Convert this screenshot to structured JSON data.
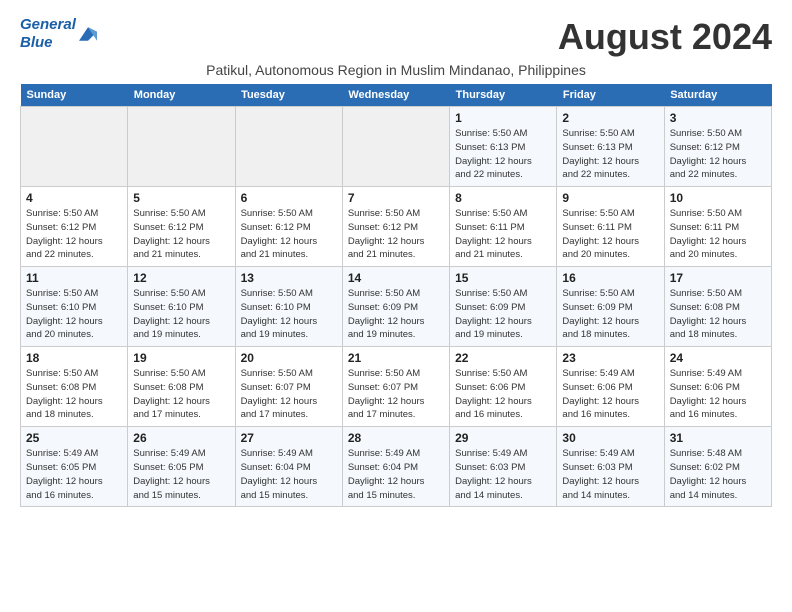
{
  "logo": {
    "line1": "General",
    "line2": "Blue"
  },
  "title": "August 2024",
  "subtitle": "Patikul, Autonomous Region in Muslim Mindanao, Philippines",
  "days_of_week": [
    "Sunday",
    "Monday",
    "Tuesday",
    "Wednesday",
    "Thursday",
    "Friday",
    "Saturday"
  ],
  "weeks": [
    [
      {
        "day": "",
        "info": ""
      },
      {
        "day": "",
        "info": ""
      },
      {
        "day": "",
        "info": ""
      },
      {
        "day": "",
        "info": ""
      },
      {
        "day": "1",
        "info": "Sunrise: 5:50 AM\nSunset: 6:13 PM\nDaylight: 12 hours\nand 22 minutes."
      },
      {
        "day": "2",
        "info": "Sunrise: 5:50 AM\nSunset: 6:13 PM\nDaylight: 12 hours\nand 22 minutes."
      },
      {
        "day": "3",
        "info": "Sunrise: 5:50 AM\nSunset: 6:12 PM\nDaylight: 12 hours\nand 22 minutes."
      }
    ],
    [
      {
        "day": "4",
        "info": "Sunrise: 5:50 AM\nSunset: 6:12 PM\nDaylight: 12 hours\nand 22 minutes."
      },
      {
        "day": "5",
        "info": "Sunrise: 5:50 AM\nSunset: 6:12 PM\nDaylight: 12 hours\nand 21 minutes."
      },
      {
        "day": "6",
        "info": "Sunrise: 5:50 AM\nSunset: 6:12 PM\nDaylight: 12 hours\nand 21 minutes."
      },
      {
        "day": "7",
        "info": "Sunrise: 5:50 AM\nSunset: 6:12 PM\nDaylight: 12 hours\nand 21 minutes."
      },
      {
        "day": "8",
        "info": "Sunrise: 5:50 AM\nSunset: 6:11 PM\nDaylight: 12 hours\nand 21 minutes."
      },
      {
        "day": "9",
        "info": "Sunrise: 5:50 AM\nSunset: 6:11 PM\nDaylight: 12 hours\nand 20 minutes."
      },
      {
        "day": "10",
        "info": "Sunrise: 5:50 AM\nSunset: 6:11 PM\nDaylight: 12 hours\nand 20 minutes."
      }
    ],
    [
      {
        "day": "11",
        "info": "Sunrise: 5:50 AM\nSunset: 6:10 PM\nDaylight: 12 hours\nand 20 minutes."
      },
      {
        "day": "12",
        "info": "Sunrise: 5:50 AM\nSunset: 6:10 PM\nDaylight: 12 hours\nand 19 minutes."
      },
      {
        "day": "13",
        "info": "Sunrise: 5:50 AM\nSunset: 6:10 PM\nDaylight: 12 hours\nand 19 minutes."
      },
      {
        "day": "14",
        "info": "Sunrise: 5:50 AM\nSunset: 6:09 PM\nDaylight: 12 hours\nand 19 minutes."
      },
      {
        "day": "15",
        "info": "Sunrise: 5:50 AM\nSunset: 6:09 PM\nDaylight: 12 hours\nand 19 minutes."
      },
      {
        "day": "16",
        "info": "Sunrise: 5:50 AM\nSunset: 6:09 PM\nDaylight: 12 hours\nand 18 minutes."
      },
      {
        "day": "17",
        "info": "Sunrise: 5:50 AM\nSunset: 6:08 PM\nDaylight: 12 hours\nand 18 minutes."
      }
    ],
    [
      {
        "day": "18",
        "info": "Sunrise: 5:50 AM\nSunset: 6:08 PM\nDaylight: 12 hours\nand 18 minutes."
      },
      {
        "day": "19",
        "info": "Sunrise: 5:50 AM\nSunset: 6:08 PM\nDaylight: 12 hours\nand 17 minutes."
      },
      {
        "day": "20",
        "info": "Sunrise: 5:50 AM\nSunset: 6:07 PM\nDaylight: 12 hours\nand 17 minutes."
      },
      {
        "day": "21",
        "info": "Sunrise: 5:50 AM\nSunset: 6:07 PM\nDaylight: 12 hours\nand 17 minutes."
      },
      {
        "day": "22",
        "info": "Sunrise: 5:50 AM\nSunset: 6:06 PM\nDaylight: 12 hours\nand 16 minutes."
      },
      {
        "day": "23",
        "info": "Sunrise: 5:49 AM\nSunset: 6:06 PM\nDaylight: 12 hours\nand 16 minutes."
      },
      {
        "day": "24",
        "info": "Sunrise: 5:49 AM\nSunset: 6:06 PM\nDaylight: 12 hours\nand 16 minutes."
      }
    ],
    [
      {
        "day": "25",
        "info": "Sunrise: 5:49 AM\nSunset: 6:05 PM\nDaylight: 12 hours\nand 16 minutes."
      },
      {
        "day": "26",
        "info": "Sunrise: 5:49 AM\nSunset: 6:05 PM\nDaylight: 12 hours\nand 15 minutes."
      },
      {
        "day": "27",
        "info": "Sunrise: 5:49 AM\nSunset: 6:04 PM\nDaylight: 12 hours\nand 15 minutes."
      },
      {
        "day": "28",
        "info": "Sunrise: 5:49 AM\nSunset: 6:04 PM\nDaylight: 12 hours\nand 15 minutes."
      },
      {
        "day": "29",
        "info": "Sunrise: 5:49 AM\nSunset: 6:03 PM\nDaylight: 12 hours\nand 14 minutes."
      },
      {
        "day": "30",
        "info": "Sunrise: 5:49 AM\nSunset: 6:03 PM\nDaylight: 12 hours\nand 14 minutes."
      },
      {
        "day": "31",
        "info": "Sunrise: 5:48 AM\nSunset: 6:02 PM\nDaylight: 12 hours\nand 14 minutes."
      }
    ]
  ]
}
